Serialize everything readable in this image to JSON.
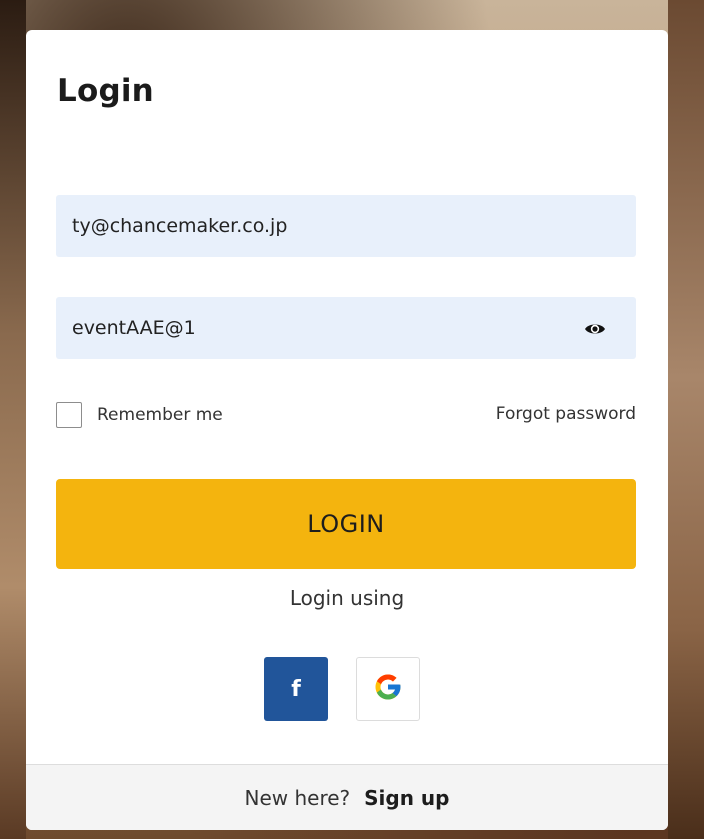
{
  "login": {
    "title": "Login",
    "email_value": "ty@chancemaker.co.jp",
    "password_value": "eventAAE@1",
    "password_toggle_icon": "eye-icon",
    "remember_label": "Remember me",
    "remember_checked": false,
    "forgot_label": "Forgot password",
    "login_button_label": "LOGIN",
    "login_using_label": "Login using",
    "social": {
      "facebook_glyph": "f",
      "facebook_icon": "facebook-icon",
      "google_icon": "google-icon"
    },
    "footer": {
      "prompt": "New here?",
      "signup_label": "Sign up"
    }
  },
  "colors": {
    "accent": "#f4b40e",
    "facebook": "#21559a",
    "input_bg": "#e8f0fb"
  }
}
